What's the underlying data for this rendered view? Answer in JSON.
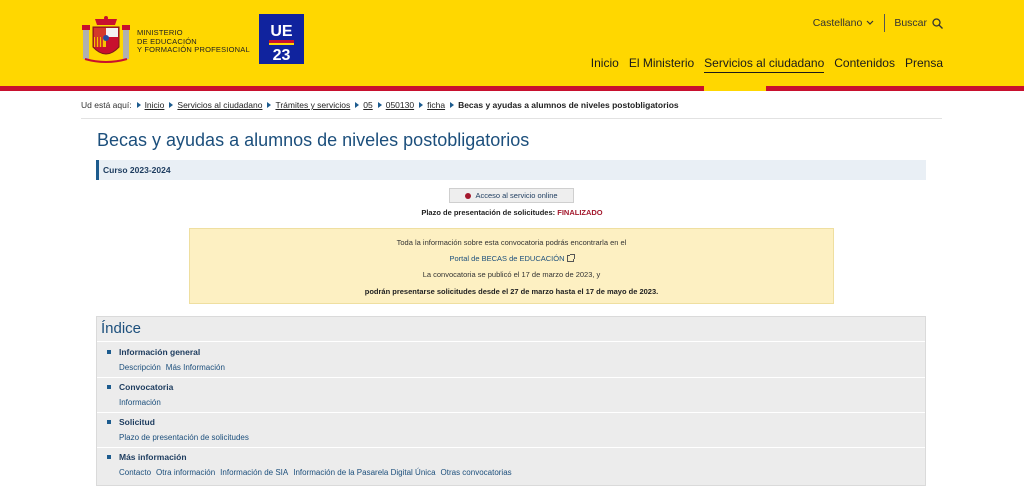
{
  "header": {
    "ministry_lines": [
      "MINISTERIO",
      "DE EDUCACIÓN",
      "Y FORMACIÓN PROFESIONAL"
    ],
    "ue23_top": "UE",
    "ue23_bottom": "23",
    "language": "Castellano",
    "search_label": "Buscar",
    "nav": [
      {
        "label": "Inicio"
      },
      {
        "label": "El Ministerio"
      },
      {
        "label": "Servicios al ciudadano"
      },
      {
        "label": "Contenidos"
      },
      {
        "label": "Prensa"
      }
    ],
    "active_nav": "Servicios al ciudadano",
    "colors": {
      "yellow": "#ffd700",
      "red": "#c8102e",
      "ue_blue": "#10239e"
    }
  },
  "breadcrumb": {
    "prefix": "Ud está aquí:",
    "items": [
      "Inicio",
      "Servicios al ciudadano",
      "Trámites y servicios",
      "05",
      "050130",
      "ficha"
    ],
    "current": "Becas y ayudas a alumnos de niveles postobligatorios"
  },
  "page": {
    "title": "Becas y ayudas a alumnos de niveles postobligatorios",
    "curso": "Curso 2023-2024",
    "access_button": "Acceso al servicio online",
    "plazo_label": "Plazo de presentación de solicitudes:",
    "plazo_status": "FINALIZADO"
  },
  "info_box": {
    "line1": "Toda la información sobre esta convocatoria podrás encontrarla en el",
    "link": "Portal de BECAS de EDUCACIÓN",
    "line3": "La convocatoria se publicó el 17 de marzo de 2023, y",
    "line4": "podrán presentarse solicitudes desde el 27 de marzo hasta el 17 de mayo de 2023."
  },
  "indice": {
    "title": "Índice",
    "sections": [
      {
        "title": "Información general",
        "links": [
          "Descripción",
          "Más Información"
        ]
      },
      {
        "title": "Convocatoria",
        "links": [
          "Información"
        ]
      },
      {
        "title": "Solicitud",
        "links": [
          "Plazo de presentación de solicitudes"
        ]
      },
      {
        "title": "Más información",
        "links": [
          "Contacto",
          "Otra información",
          "Información de SIA",
          "Información de la Pasarela Digital Única",
          "Otras convocatorias"
        ]
      }
    ]
  }
}
